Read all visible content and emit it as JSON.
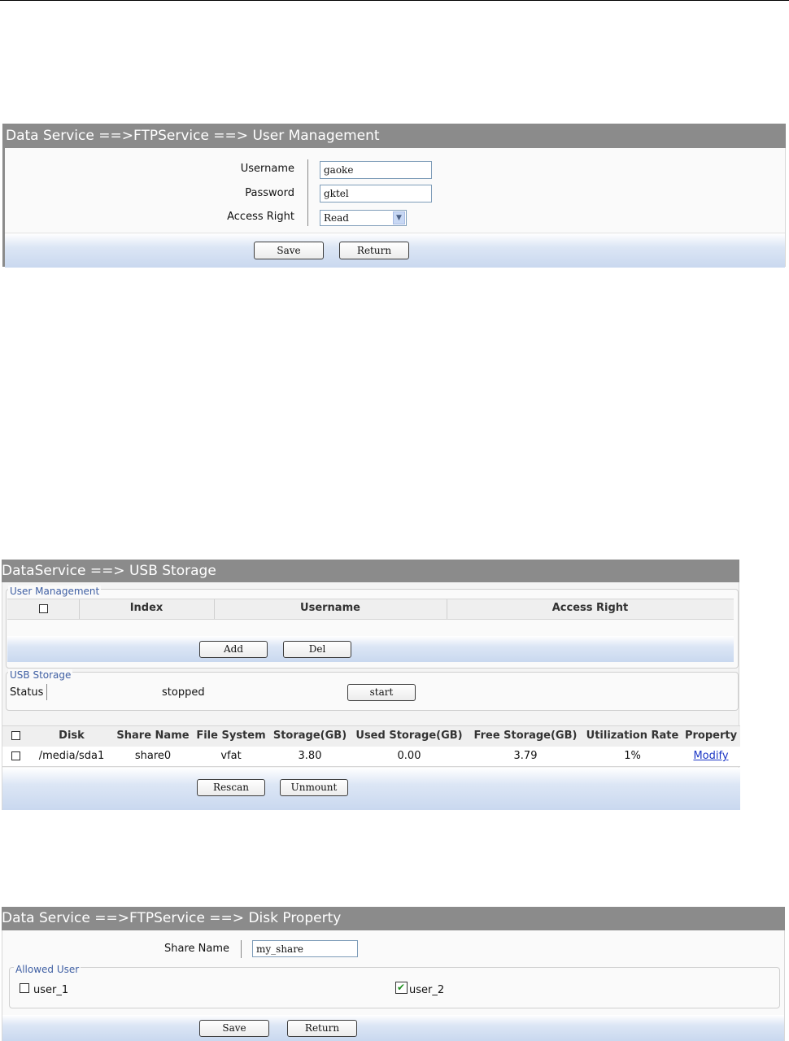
{
  "user_management_form": {
    "title": "Data Service ==>FTPService ==> User Management",
    "username_label": "Username",
    "username_value": "gaoke",
    "password_label": "Password",
    "password_value": "gktel",
    "access_label": "Access Right",
    "access_value": "Read",
    "save_label": "Save",
    "return_label": "Return"
  },
  "usb_storage_page": {
    "title": "DataService ==> USB Storage",
    "user_group_title": "User Management",
    "user_table_headers": [
      "Index",
      "Username",
      "Access Right"
    ],
    "add_label": "Add",
    "del_label": "Del",
    "usb_group_title": "USB Storage",
    "status_label": "Status",
    "status_value": "stopped",
    "start_label": "start",
    "disk_table_headers": [
      "Disk",
      "Share Name",
      "File System",
      "Storage(GB)",
      "Used Storage(GB)",
      "Free Storage(GB)",
      "Utilization Rate",
      "Property"
    ],
    "disk_rows": [
      {
        "disk": "/media/sda1",
        "share_name": "share0",
        "file_system": "vfat",
        "storage": "3.80",
        "used": "0.00",
        "free": "3.79",
        "utilization": "1%",
        "property": "Modify"
      }
    ],
    "rescan_label": "Rescan",
    "unmount_label": "Unmount"
  },
  "disk_property_form": {
    "title": "Data Service ==>FTPService ==> Disk Property",
    "share_name_label": "Share Name",
    "share_name_value": "my_share",
    "allowed_group_title": "Allowed User",
    "users": [
      {
        "name": "user_1",
        "checked": false
      },
      {
        "name": "user_2",
        "checked": true
      }
    ],
    "save_label": "Save",
    "return_label": "Return"
  }
}
